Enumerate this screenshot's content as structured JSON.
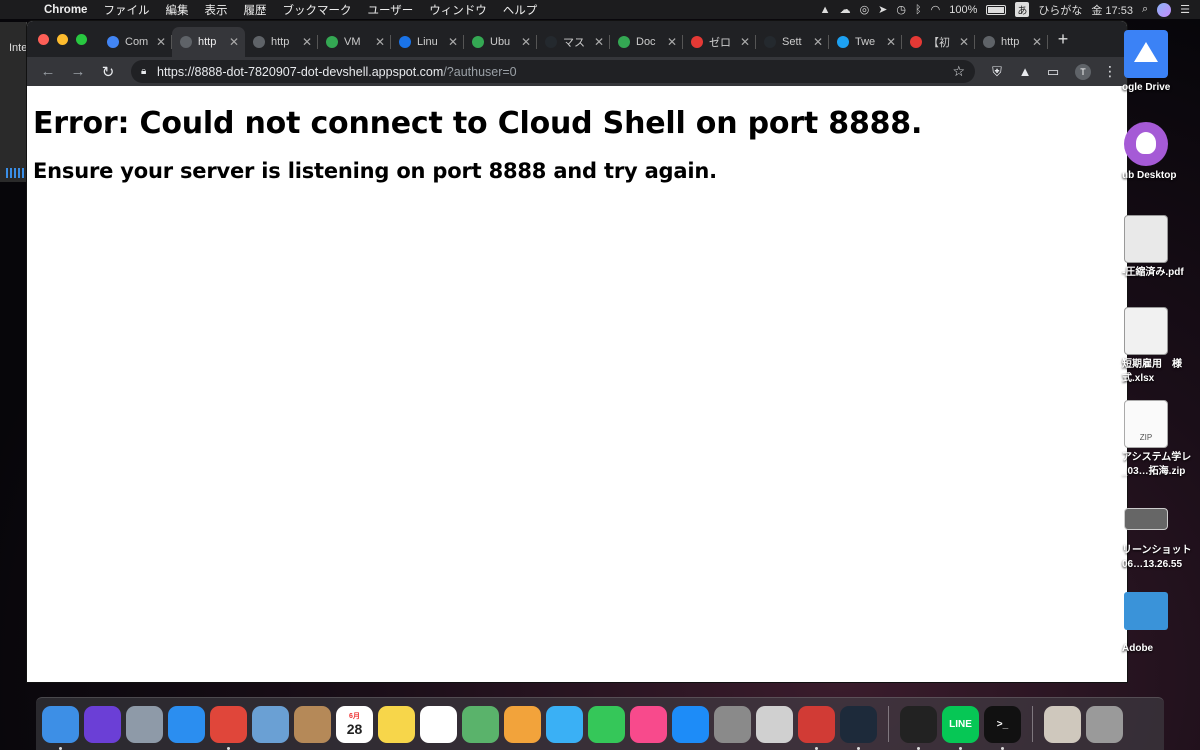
{
  "menubar": {
    "app_name": "Chrome",
    "items": [
      "ファイル",
      "編集",
      "表示",
      "履歴",
      "ブックマーク",
      "ユーザー",
      "ウィンドウ",
      "ヘルプ"
    ],
    "battery": "100%",
    "ime": "あ",
    "input_mode": "ひらがな",
    "clock": "金 17:53"
  },
  "left_window": {
    "title": "Inte"
  },
  "browser": {
    "tabs": [
      {
        "title": "Com",
        "favicon_color": "#4285f4",
        "icon": "compute-icon"
      },
      {
        "title": "http",
        "favicon_color": "#5f6368",
        "icon": "globe-icon",
        "active": true
      },
      {
        "title": "http",
        "favicon_color": "#5f6368",
        "icon": "globe-icon"
      },
      {
        "title": "VM",
        "favicon_color": "#34a853",
        "icon": "gcp-icon"
      },
      {
        "title": "Linu",
        "favicon_color": "#1a73e8",
        "icon": "linux-icon"
      },
      {
        "title": "Ubu",
        "favicon_color": "#34a853",
        "icon": "qiita-icon"
      },
      {
        "title": "マス",
        "favicon_color": "#24292e",
        "icon": "github-icon"
      },
      {
        "title": "Doc",
        "favicon_color": "#34a853",
        "icon": "qiita-icon"
      },
      {
        "title": "ゼロ",
        "favicon_color": "#e53935",
        "icon": "udemy-icon"
      },
      {
        "title": "Sett",
        "favicon_color": "#24292e",
        "icon": "github-icon"
      },
      {
        "title": "Twe",
        "favicon_color": "#1da1f2",
        "icon": "twitter-icon"
      },
      {
        "title": "【初",
        "favicon_color": "#e53935",
        "icon": "red-circle-icon"
      },
      {
        "title": "http",
        "favicon_color": "#5f6368",
        "icon": "globe-icon"
      }
    ],
    "new_tab": "+",
    "url_main": "https://8888-dot-7820907-dot-devshell.appspot.com",
    "url_rest": "/?authuser=0",
    "profile_initial": "T"
  },
  "page": {
    "heading": "Error: Could not connect to Cloud Shell on port 8888.",
    "subheading": "Ensure your server is listening on port 8888 and try again."
  },
  "desktop": [
    {
      "label": "ogle Drive",
      "icon": "google-drive-icon"
    },
    {
      "label": "ub Desktop",
      "icon": "github-desktop-icon"
    },
    {
      "label": "-圧縮済み.pdf",
      "icon": "pdf-document-icon"
    },
    {
      "label": "短期雇用　様式.xlsx",
      "icon": "xlsx-document-icon"
    },
    {
      "label": "アシステム学レ_03…拓海.zip",
      "icon": "zip-archive-icon",
      "badge": "ZIP"
    },
    {
      "label": "リーンショット 06…13.26.55",
      "icon": "screenshot-icon"
    },
    {
      "label": "Adobe",
      "icon": "folder-icon"
    }
  ],
  "dock": {
    "apps": [
      {
        "name": "finder-icon",
        "color": "#3d8fe6",
        "running": true
      },
      {
        "name": "siri-icon",
        "color": "#6b3fd6",
        "running": false
      },
      {
        "name": "launchpad-icon",
        "color": "#8e9aa8",
        "running": false
      },
      {
        "name": "safari-icon",
        "color": "#2b8ef0",
        "running": false
      },
      {
        "name": "chrome-icon",
        "color": "#e0463a",
        "running": true
      },
      {
        "name": "preview-icon",
        "color": "#6aa0d4",
        "running": false
      },
      {
        "name": "contacts-icon",
        "color": "#b58958",
        "running": false
      },
      {
        "name": "calendar-icon",
        "color": "#ffffff",
        "running": false,
        "text": "28",
        "month": "6月"
      },
      {
        "name": "notes-icon",
        "color": "#f7d64a",
        "running": false
      },
      {
        "name": "reminders-icon",
        "color": "#ffffff",
        "running": false
      },
      {
        "name": "maps-icon",
        "color": "#5ab36b",
        "running": false
      },
      {
        "name": "photos-icon",
        "color": "#f2a33b",
        "running": false
      },
      {
        "name": "messages-icon",
        "color": "#3ab0f5",
        "running": false
      },
      {
        "name": "facetime-icon",
        "color": "#35c759",
        "running": false
      },
      {
        "name": "itunes-icon",
        "color": "#f84a8c",
        "running": false
      },
      {
        "name": "app-store-icon",
        "color": "#1d8cf8",
        "running": false
      },
      {
        "name": "system-preferences-icon",
        "color": "#8a8a8a",
        "running": false
      },
      {
        "name": "sheet-music-icon",
        "color": "#d0d0d0",
        "running": false
      },
      {
        "name": "parallels-icon",
        "color": "#d13b35",
        "running": true
      },
      {
        "name": "activity-monitor-icon",
        "color": "#1d2a3a",
        "running": true
      },
      {
        "name": "piano-icon",
        "color": "#222222",
        "running": true
      },
      {
        "name": "line-icon",
        "color": "#06c755",
        "running": true,
        "text": "LINE"
      },
      {
        "name": "terminal-icon",
        "color": "#111111",
        "running": true,
        "text": ">_"
      },
      {
        "name": "downloads-stack-icon",
        "color": "#cfc8bd",
        "running": false
      },
      {
        "name": "trash-icon",
        "color": "#9a9a9a",
        "running": false
      }
    ]
  }
}
